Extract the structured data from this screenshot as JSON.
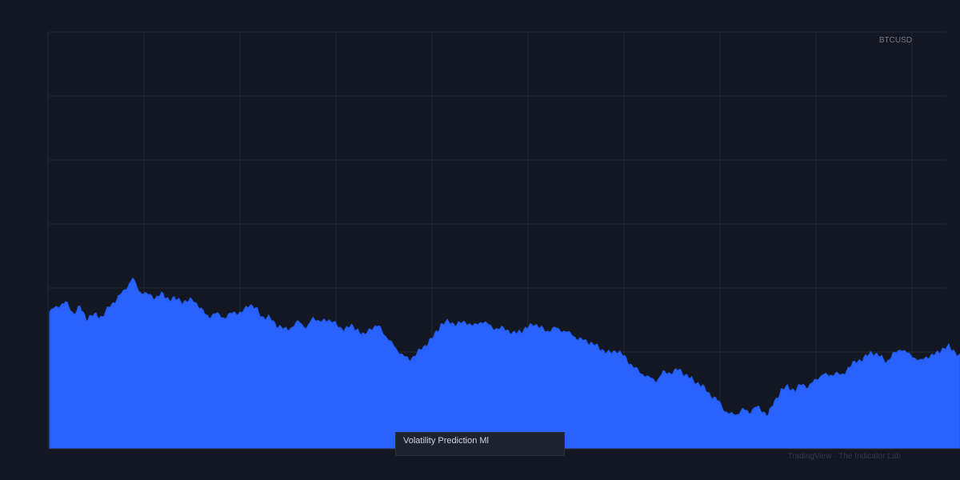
{
  "symbol_label": "BTCUSD",
  "indicator_label": "Volatility Prediction Ml",
  "watermark": "TradingView · The Indicator Lab",
  "colors": {
    "background": "#131722",
    "grid": "#232733",
    "area_fill": "#2962ff",
    "area_stroke": "#2158e8"
  },
  "chart_data": {
    "type": "area",
    "title": "",
    "xlabel": "",
    "ylabel": "",
    "ylim": [
      0,
      520
    ],
    "grid": true,
    "series": [
      {
        "name": "",
        "x_index_range": [
          0,
          1140
        ],
        "keypoints": [
          [
            0,
            170
          ],
          [
            8,
            176
          ],
          [
            20,
            182
          ],
          [
            30,
            168
          ],
          [
            38,
            176
          ],
          [
            46,
            162
          ],
          [
            56,
            166
          ],
          [
            66,
            164
          ],
          [
            76,
            178
          ],
          [
            86,
            188
          ],
          [
            96,
            200
          ],
          [
            104,
            212
          ],
          [
            112,
            196
          ],
          [
            122,
            192
          ],
          [
            132,
            188
          ],
          [
            140,
            192
          ],
          [
            150,
            186
          ],
          [
            160,
            186
          ],
          [
            170,
            182
          ],
          [
            180,
            186
          ],
          [
            190,
            172
          ],
          [
            200,
            164
          ],
          [
            210,
            168
          ],
          [
            220,
            162
          ],
          [
            230,
            170
          ],
          [
            240,
            168
          ],
          [
            250,
            180
          ],
          [
            258,
            174
          ],
          [
            266,
            164
          ],
          [
            276,
            162
          ],
          [
            284,
            154
          ],
          [
            294,
            148
          ],
          [
            302,
            150
          ],
          [
            312,
            158
          ],
          [
            322,
            150
          ],
          [
            330,
            162
          ],
          [
            342,
            158
          ],
          [
            354,
            160
          ],
          [
            364,
            148
          ],
          [
            376,
            152
          ],
          [
            386,
            148
          ],
          [
            394,
            140
          ],
          [
            402,
            150
          ],
          [
            412,
            152
          ],
          [
            424,
            136
          ],
          [
            434,
            124
          ],
          [
            442,
            116
          ],
          [
            450,
            110
          ],
          [
            460,
            118
          ],
          [
            470,
            128
          ],
          [
            480,
            138
          ],
          [
            490,
            154
          ],
          [
            500,
            158
          ],
          [
            510,
            154
          ],
          [
            520,
            158
          ],
          [
            530,
            152
          ],
          [
            540,
            158
          ],
          [
            550,
            154
          ],
          [
            560,
            148
          ],
          [
            570,
            150
          ],
          [
            580,
            142
          ],
          [
            588,
            146
          ],
          [
            596,
            148
          ],
          [
            606,
            156
          ],
          [
            614,
            150
          ],
          [
            624,
            146
          ],
          [
            634,
            150
          ],
          [
            644,
            146
          ],
          [
            654,
            142
          ],
          [
            662,
            136
          ],
          [
            672,
            134
          ],
          [
            680,
            130
          ],
          [
            690,
            124
          ],
          [
            700,
            118
          ],
          [
            710,
            122
          ],
          [
            720,
            114
          ],
          [
            730,
            102
          ],
          [
            740,
            94
          ],
          [
            750,
            88
          ],
          [
            760,
            84
          ],
          [
            768,
            94
          ],
          [
            778,
            94
          ],
          [
            788,
            98
          ],
          [
            798,
            90
          ],
          [
            806,
            84
          ],
          [
            814,
            80
          ],
          [
            822,
            72
          ],
          [
            830,
            64
          ],
          [
            838,
            58
          ],
          [
            846,
            46
          ],
          [
            852,
            42
          ],
          [
            860,
            42
          ],
          [
            868,
            48
          ],
          [
            876,
            44
          ],
          [
            884,
            52
          ],
          [
            892,
            46
          ],
          [
            900,
            42
          ],
          [
            908,
            58
          ],
          [
            916,
            72
          ],
          [
            924,
            76
          ],
          [
            934,
            72
          ],
          [
            942,
            80
          ],
          [
            950,
            76
          ],
          [
            958,
            84
          ],
          [
            968,
            92
          ],
          [
            976,
            90
          ],
          [
            984,
            94
          ],
          [
            992,
            90
          ],
          [
            1000,
            100
          ],
          [
            1010,
            108
          ],
          [
            1020,
            112
          ],
          [
            1030,
            120
          ],
          [
            1040,
            114
          ],
          [
            1048,
            108
          ],
          [
            1058,
            118
          ],
          [
            1066,
            124
          ],
          [
            1074,
            118
          ],
          [
            1082,
            114
          ],
          [
            1090,
            108
          ],
          [
            1098,
            114
          ],
          [
            1108,
            116
          ],
          [
            1118,
            124
          ],
          [
            1126,
            126
          ],
          [
            1132,
            122
          ],
          [
            1140,
            114
          ]
        ]
      }
    ]
  }
}
